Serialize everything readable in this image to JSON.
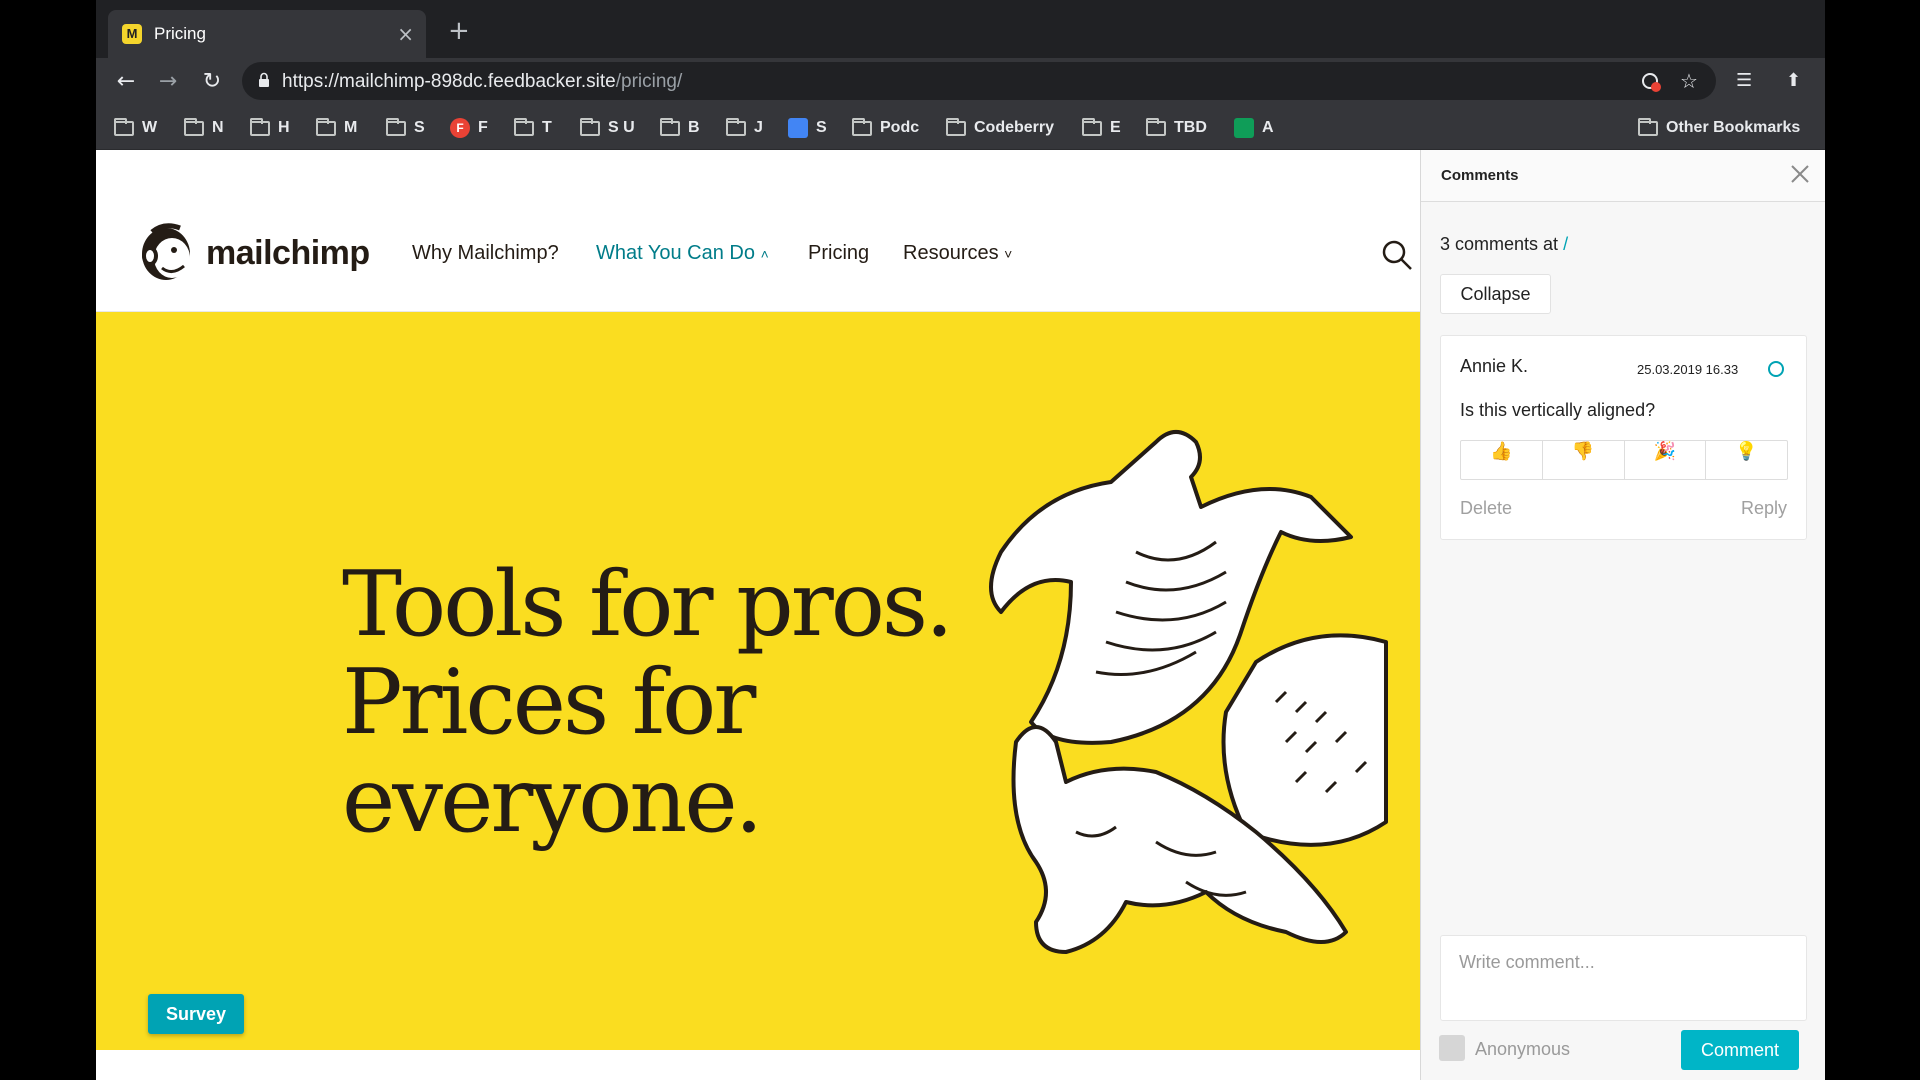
{
  "browser": {
    "tab_title": "Pricing",
    "tab_favicon": "M",
    "tab_close": "×",
    "new_tab": "+",
    "url_host": "https://mailchimp-898dc.feedbacker.site",
    "url_path": "/pricing/",
    "bookmarks": [
      "W",
      "N",
      "H",
      "M",
      "S",
      "F",
      "T",
      "S U",
      "B",
      "J",
      "S",
      "Podc",
      "Codeberry",
      "E",
      "TBD",
      "A"
    ],
    "bookmark_badge_f": "F",
    "other_bookmarks": "Other Bookmarks"
  },
  "site": {
    "logo_text": "mailchimp",
    "nav": {
      "why": "Why Mailchimp?",
      "what": "What You Can Do",
      "what_caret": "˄",
      "pricing": "Pricing",
      "resources": "Resources",
      "resources_caret": "˅"
    },
    "hero": {
      "line1": "Tools for pros.",
      "line2": "Prices for",
      "line3": "everyone."
    },
    "survey_label": "Survey"
  },
  "comments": {
    "title": "Comments",
    "count_text": "3 comments at",
    "count_link": "/",
    "collapse_label": "Collapse",
    "items": [
      {
        "author": "Annie K.",
        "date": "25.03.2019 16.33",
        "text": "Is this vertically aligned?",
        "reactions": [
          "👍",
          "👎",
          "🎉",
          "💡"
        ],
        "delete_label": "Delete",
        "reply_label": "Reply"
      }
    ],
    "compose_placeholder": "Write comment...",
    "anonymous_label": "Anonymous",
    "submit_label": "Comment",
    "accent_color": "#00a3b4"
  },
  "colors": {
    "hero_yellow": "#fadd20",
    "nav_active": "#007c89"
  }
}
